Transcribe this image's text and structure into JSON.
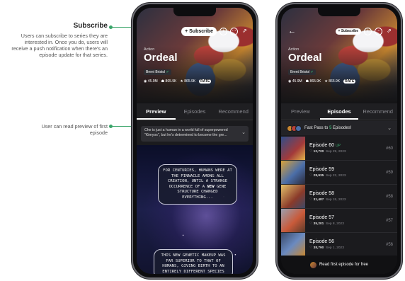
{
  "annotations": {
    "subscribe": {
      "heading": "Subscribe",
      "body": "Users can subscribe to series they are interested in. Once you do, users will receive a push notification when there's an episode update for that series."
    },
    "preview": {
      "body": "User can read preview of first episode"
    },
    "accent_color": "#3aa56a"
  },
  "series": {
    "genre": "Action",
    "title": "Ordeal",
    "author": "Brent Bristol",
    "views": "45.9M",
    "subscribers": "865.9K",
    "likes": "865.9K",
    "rating_badge": "RATE"
  },
  "phone1": {
    "subscribe_label": "+ Subscribe",
    "icons": [
      "info-icon",
      "more-icon",
      "share-icon"
    ],
    "tabs": [
      "Preview",
      "Episodes",
      "Recommend"
    ],
    "active_tab": "Preview",
    "synopsis": "Che is just a human in a world full of superpowered \"Kimyos\", but he's determined to become the gre...",
    "bubble1": {
      "line1": "For centuries, humans were at the pinnacle among all creation, until a strange occurrence of a",
      "emph": "new",
      "line2": "gene structure changed everything..."
    },
    "bubble2": "This new genetic makeup was far superior to that of humans, giving birth to an entirely different species"
  },
  "phone2": {
    "back_label": "←",
    "subscribe_label": "+ Subscribe",
    "tabs": [
      "Preview",
      "Episodes",
      "Recommend"
    ],
    "active_tab": "Episodes",
    "fastpass": {
      "prefix": "Fast Pass to",
      "count": "5",
      "suffix": "Episodes!"
    },
    "episodes": [
      {
        "title": "Episode 60",
        "badge": "UP",
        "likes": "12,720",
        "date": "Sep 29, 2023",
        "number": "#60"
      },
      {
        "title": "Episode 59",
        "badge": "",
        "likes": "28,935",
        "date": "Sep 22, 2023",
        "number": "#59"
      },
      {
        "title": "Episode 58",
        "badge": "",
        "likes": "31,487",
        "date": "Sep 15, 2023",
        "number": "#58"
      },
      {
        "title": "Episode 57",
        "badge": "",
        "likes": "35,201",
        "date": "Sep 8, 2023",
        "number": "#57"
      },
      {
        "title": "Episode 56",
        "badge": "",
        "likes": "38,790",
        "date": "Sep 1, 2023",
        "number": "#56"
      }
    ],
    "read_first": "Read first episode for free"
  }
}
